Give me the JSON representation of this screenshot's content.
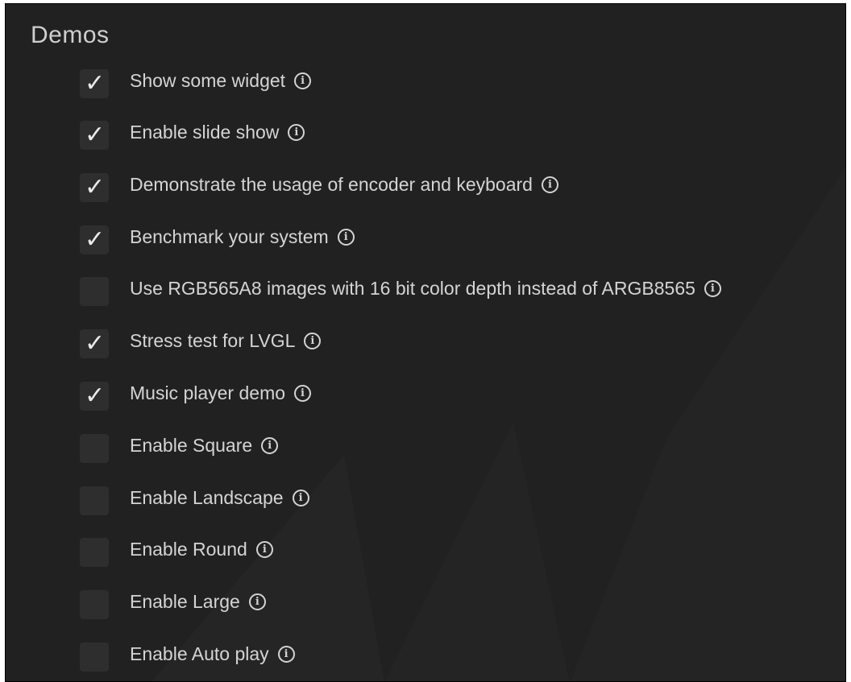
{
  "section": {
    "title": "Demos"
  },
  "items": [
    {
      "label": "Show some widget",
      "checked": true
    },
    {
      "label": "Enable slide show",
      "checked": true
    },
    {
      "label": "Demonstrate the usage of encoder and keyboard",
      "checked": true
    },
    {
      "label": "Benchmark your system",
      "checked": true
    },
    {
      "label": "Use RGB565A8 images with 16 bit color depth instead of ARGB8565",
      "checked": false
    },
    {
      "label": "Stress test for LVGL",
      "checked": true
    },
    {
      "label": "Music player demo",
      "checked": true
    },
    {
      "label": "Enable Square",
      "checked": false
    },
    {
      "label": "Enable Landscape",
      "checked": false
    },
    {
      "label": "Enable Round",
      "checked": false
    },
    {
      "label": "Enable Large",
      "checked": false
    },
    {
      "label": "Enable Auto play",
      "checked": false
    }
  ],
  "icons": {
    "check": "checkmark-icon",
    "info": "info-icon"
  },
  "colors": {
    "background": "#212121",
    "checkbox": "#2e2e2e",
    "text": "#d4d4d4"
  }
}
